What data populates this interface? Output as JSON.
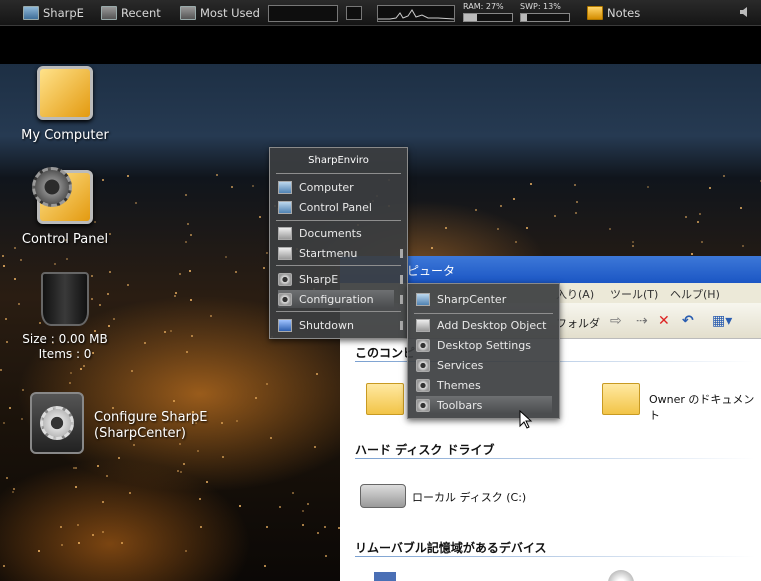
{
  "taskbar": {
    "items": [
      {
        "label": "SharpE",
        "icon": "sharpe-icon"
      },
      {
        "label": "Recent",
        "icon": "recent-icon"
      },
      {
        "label": "Most Used",
        "icon": "most-used-icon"
      }
    ],
    "ram_label": "RAM: 27%",
    "ram_percent": 27,
    "swp_label": "SWP: 13%",
    "swp_percent": 13,
    "notes_label": "Notes",
    "volume_icon": "speaker-icon"
  },
  "desktop": {
    "icons": [
      {
        "label": "My Computer",
        "icon": "my-computer-icon"
      },
      {
        "label": "Control Panel",
        "icon": "control-panel-icon"
      }
    ],
    "recycle": {
      "size_text": "Size : 0.00 MB",
      "items_text": "Items : 0"
    },
    "configure": {
      "line1": "Configure SharpE",
      "line2": "(SharpCenter)"
    }
  },
  "main_menu": {
    "title": "SharpEnviro",
    "items": [
      "Computer",
      "Control Panel",
      "Documents",
      "Startmenu",
      "SharpE",
      "Configuration",
      "Shutdown"
    ],
    "highlighted": "Configuration"
  },
  "sub_menu": {
    "items": [
      "SharpCenter",
      "Add Desktop Object",
      "Desktop Settings",
      "Services",
      "Themes",
      "Toolbars"
    ],
    "highlighted": "Toolbars"
  },
  "explorer": {
    "title": "ピュータ",
    "menu": [
      "入り(A)",
      "ツール(T)",
      "ヘルプ(H)"
    ],
    "toolbar_folder_label": "フォルダ",
    "section_partial": "このコンピ",
    "owner_docs": "Owner のドキュメント",
    "hdd_section": "ハード ディスク ドライブ",
    "local_disk": "ローカル ディスク (C:)",
    "removable_section": "リムーバブル記憶域があるデバイス"
  }
}
